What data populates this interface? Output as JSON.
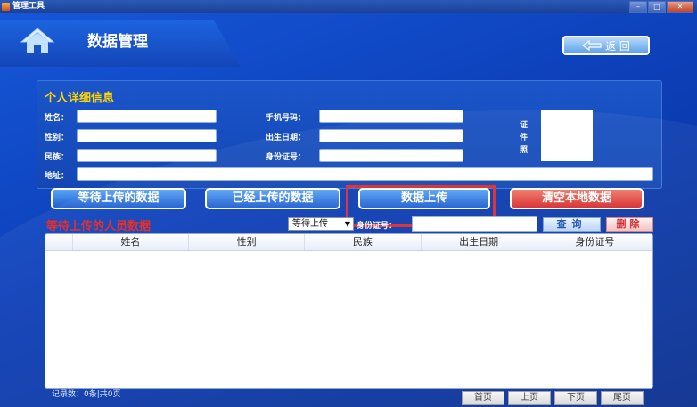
{
  "window": {
    "title": "管理工具"
  },
  "header": {
    "page_title": "数据管理",
    "back_label": "返 回"
  },
  "info": {
    "section_title": "个人详细信息",
    "name_label": "姓名：",
    "gender_label": "性别：",
    "ethnicity_label": "民族：",
    "address_label": "地址：",
    "phone_label": "手机号码：",
    "birth_label": "出生日期：",
    "id_label": "身份证号：",
    "photo_label_1": "证",
    "photo_label_2": "件",
    "photo_label_3": "照"
  },
  "actions": {
    "pending": "等待上传的数据",
    "uploaded": "已经上传的数据",
    "upload": "数据上传",
    "clear": "清空本地数据"
  },
  "list": {
    "title": "等待上传的人员数据",
    "filter_selected": "等待上传",
    "id_search_label": "身份证号：",
    "query_label": "查询",
    "delete_label": "删除",
    "columns": [
      "姓名",
      "性别",
      "民族",
      "出生日期",
      "身份证号"
    ]
  },
  "footer": {
    "count": "记录数：0条|共0页",
    "first": "首页",
    "prev": "上页",
    "next": "下页",
    "last": "尾页"
  }
}
